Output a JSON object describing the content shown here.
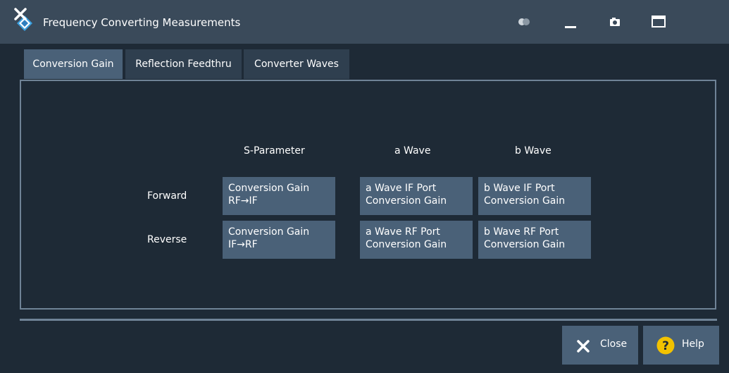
{
  "window": {
    "title": "Frequency Converting Measurements",
    "icons": [
      "rs-logo-icon",
      "toggle-icon",
      "minimize-icon",
      "camera-icon",
      "maximize-icon",
      "close-icon"
    ],
    "colors": {
      "titlebar": "#3a4a5a",
      "close": "#c4373a",
      "background": "#1e2a36",
      "cell": "#4a6178"
    }
  },
  "tabs": [
    {
      "label": "Conversion Gain",
      "active": true
    },
    {
      "label": "Reflection Feedthru",
      "active": false
    },
    {
      "label": "Converter Waves",
      "active": false
    }
  ],
  "grid": {
    "columns": [
      "S-Parameter",
      "a Wave",
      "b Wave"
    ],
    "rows": [
      {
        "label": "Forward",
        "cells": [
          [
            "Conversion Gain",
            "RF→IF"
          ],
          [
            "a Wave IF Port",
            "Conversion Gain"
          ],
          [
            "b Wave IF Port",
            "Conversion Gain"
          ]
        ]
      },
      {
        "label": "Reverse",
        "cells": [
          [
            "Conversion Gain",
            "IF→RF"
          ],
          [
            "a Wave RF Port",
            "Conversion Gain"
          ],
          [
            "b Wave RF Port",
            "Conversion Gain"
          ]
        ]
      }
    ]
  },
  "footer": {
    "close_label": "Close",
    "help_label": "Help"
  }
}
